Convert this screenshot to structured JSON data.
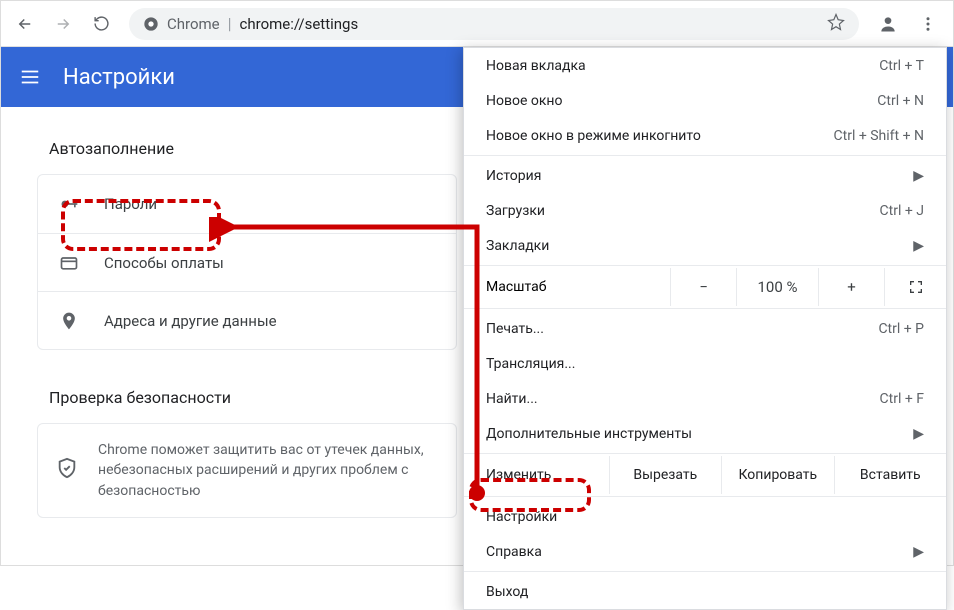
{
  "omnibox": {
    "label": "Chrome",
    "url": "chrome://settings"
  },
  "header": {
    "title": "Настройки"
  },
  "autofill": {
    "title": "Автозаполнение",
    "rows": {
      "passwords": "Пароли",
      "payments": "Способы оплаты",
      "addresses": "Адреса и другие данные"
    }
  },
  "safety": {
    "title": "Проверка безопасности",
    "desc": "Chrome поможет защитить вас от утечек данных, небезопасных расширений и других проблем с безопасностью"
  },
  "menu": {
    "newTab": {
      "label": "Новая вкладка",
      "shortcut": "Ctrl + T"
    },
    "newWindow": {
      "label": "Новое окно",
      "shortcut": "Ctrl + N"
    },
    "incognito": {
      "label": "Новое окно в режиме инкогнито",
      "shortcut": "Ctrl + Shift + N"
    },
    "history": {
      "label": "История"
    },
    "downloads": {
      "label": "Загрузки",
      "shortcut": "Ctrl + J"
    },
    "bookmarks": {
      "label": "Закладки"
    },
    "zoom": {
      "label": "Масштаб",
      "minus": "−",
      "value": "100 %",
      "plus": "+"
    },
    "print": {
      "label": "Печать...",
      "shortcut": "Ctrl + P"
    },
    "cast": {
      "label": "Трансляция..."
    },
    "find": {
      "label": "Найти...",
      "shortcut": "Ctrl + F"
    },
    "tools": {
      "label": "Дополнительные инструменты"
    },
    "edit": {
      "label": "Изменить",
      "cut": "Вырезать",
      "copy": "Копировать",
      "paste": "Вставить"
    },
    "settings": {
      "label": "Настройки"
    },
    "help": {
      "label": "Справка"
    },
    "exit": {
      "label": "Выход"
    }
  }
}
